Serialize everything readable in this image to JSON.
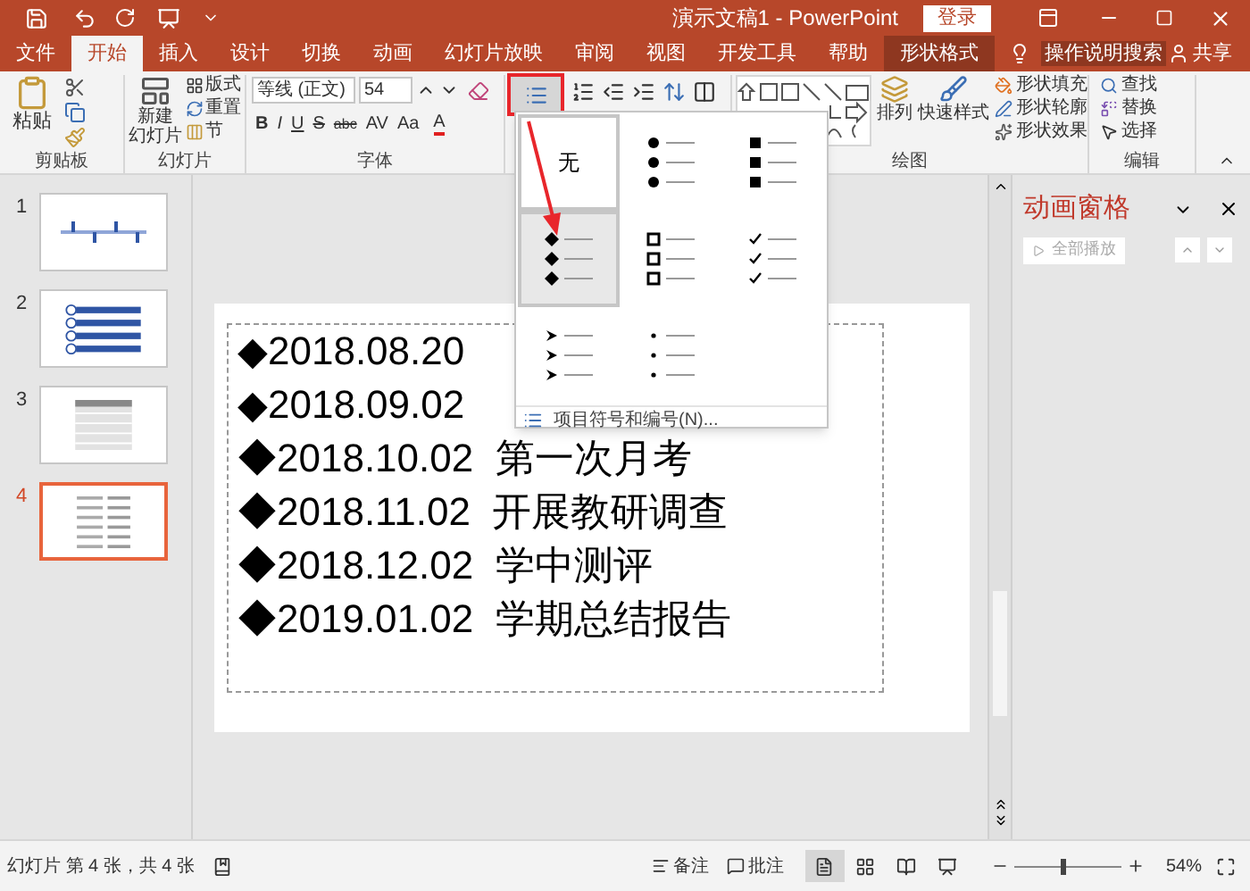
{
  "title_bar": {
    "title": "演示文稿1 - PowerPoint",
    "login": "登录"
  },
  "tabs": [
    {
      "label": "文件",
      "selected": false,
      "kind": "normal"
    },
    {
      "label": "开始",
      "selected": true,
      "kind": "normal"
    },
    {
      "label": "插入",
      "selected": false,
      "kind": "normal"
    },
    {
      "label": "设计",
      "selected": false,
      "kind": "normal"
    },
    {
      "label": "切换",
      "selected": false,
      "kind": "normal"
    },
    {
      "label": "动画",
      "selected": false,
      "kind": "normal"
    },
    {
      "label": "幻灯片放映",
      "selected": false,
      "kind": "normal"
    },
    {
      "label": "审阅",
      "selected": false,
      "kind": "normal"
    },
    {
      "label": "视图",
      "selected": false,
      "kind": "normal"
    },
    {
      "label": "开发工具",
      "selected": false,
      "kind": "normal"
    },
    {
      "label": "帮助",
      "selected": false,
      "kind": "normal"
    },
    {
      "label": "形状格式",
      "selected": false,
      "kind": "contextual"
    }
  ],
  "tell_me": "操作说明搜索",
  "share": "共享",
  "ribbon": {
    "clipboard": {
      "paste": "粘贴",
      "label": "剪贴板"
    },
    "slides": {
      "new_slide": [
        "新建",
        "幻灯片"
      ],
      "layout": "版式",
      "reset": "重置",
      "section": "节",
      "label": "幻灯片"
    },
    "font": {
      "name": "等线 (正文)",
      "size": "54",
      "formats": [
        "B",
        "I",
        "U",
        "S",
        "abc",
        "AV",
        "Aa"
      ],
      "color_letter": "A",
      "label": "字体"
    },
    "drawing": {
      "arrange": "排列",
      "quick_styles": "快速样式",
      "fill": "形状填充",
      "outline": "形状轮廓",
      "effects": "形状效果",
      "label": "绘图"
    },
    "editing": {
      "find": "查找",
      "replace": "替换",
      "select": "选择",
      "label": "编辑"
    }
  },
  "bullet_menu": {
    "options": [
      {
        "kind": "none",
        "label": "无",
        "outlined": true,
        "selected": false
      },
      {
        "kind": "circle",
        "outlined": false,
        "selected": false
      },
      {
        "kind": "square",
        "outlined": false,
        "selected": false
      },
      {
        "kind": "diamond",
        "outlined": true,
        "selected": true
      },
      {
        "kind": "hollow-square",
        "outlined": false,
        "selected": false
      },
      {
        "kind": "check",
        "outlined": false,
        "selected": false
      },
      {
        "kind": "arrow",
        "outlined": false,
        "selected": false
      },
      {
        "kind": "dot",
        "outlined": false,
        "selected": false
      }
    ],
    "footer": "项目符号和编号(N)..."
  },
  "thumbnails": [
    {
      "number": "1",
      "kind": "timeline",
      "selected": false
    },
    {
      "number": "2",
      "kind": "steps",
      "selected": false
    },
    {
      "number": "3",
      "kind": "table",
      "selected": false
    },
    {
      "number": "4",
      "kind": "text",
      "selected": true
    }
  ],
  "slide": {
    "lines": [
      "◆2018.08.20",
      "◆2018.09.02",
      "◆2018.10.02  第一次月考",
      "◆2018.11.02  开展教研调查",
      "◆2018.12.02  学中测评",
      "◆2019.01.02  学期总结报告"
    ]
  },
  "animation_pane": {
    "title": "动画窗格",
    "play_all": "全部播放",
    "play_all_disabled": true
  },
  "status_bar": {
    "slide_info": "幻灯片 第 4 张，共 4 张",
    "notes": "备注",
    "comments": "批注",
    "views": [
      {
        "kind": "normal",
        "selected": true
      },
      {
        "kind": "sorter",
        "selected": false
      },
      {
        "kind": "reading",
        "selected": false
      },
      {
        "kind": "show",
        "selected": false
      }
    ],
    "zoom": {
      "level": 0.45,
      "reading": "54%"
    }
  }
}
